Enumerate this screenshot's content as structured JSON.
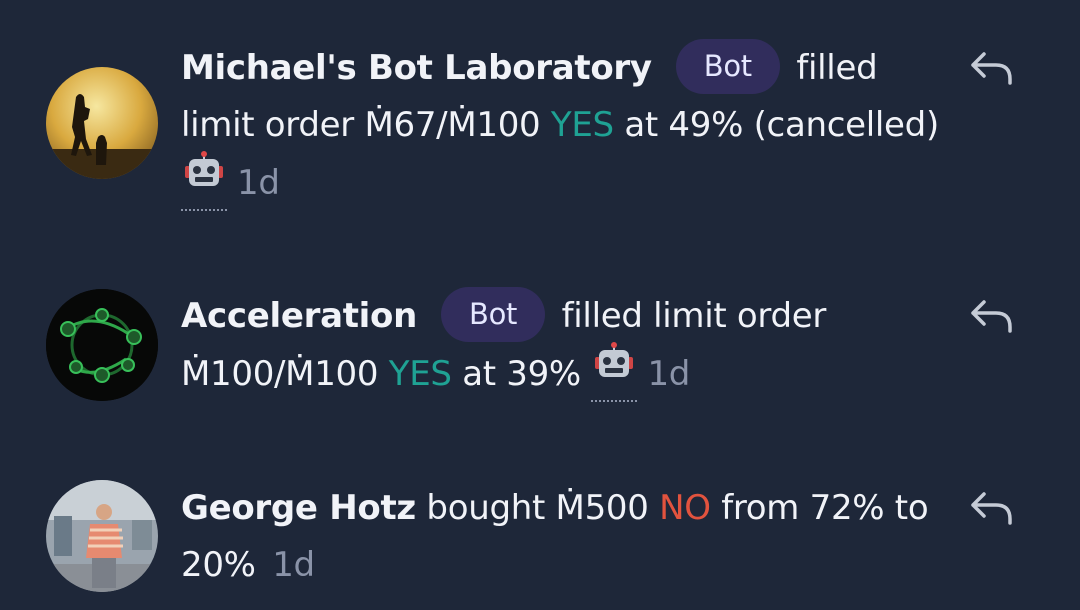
{
  "feed": {
    "items": [
      {
        "name": "Michael's Bot Laboratory",
        "badge": "Bot",
        "action": "filled limit order",
        "amount": "Ṁ67/Ṁ100",
        "outcome": "YES",
        "rest": "at 49% (cancelled)",
        "time": "1d"
      },
      {
        "name": "Acceleration",
        "badge": "Bot",
        "action": "filled limit order",
        "amount": "Ṁ100/Ṁ100",
        "outcome": "YES",
        "rest": "at 39%",
        "time": "1d"
      },
      {
        "name": "George Hotz",
        "action": "bought",
        "amount": "Ṁ500",
        "outcome": "NO",
        "rest": "from 72% to 20%",
        "time": "1d"
      }
    ]
  },
  "colors": {
    "background": "#1e2739",
    "yes": "#1fa294",
    "no": "#e2533e",
    "badge": "#312d5c",
    "muted": "#8a93a8"
  },
  "icons": [
    "robot-icon",
    "reply-icon"
  ]
}
